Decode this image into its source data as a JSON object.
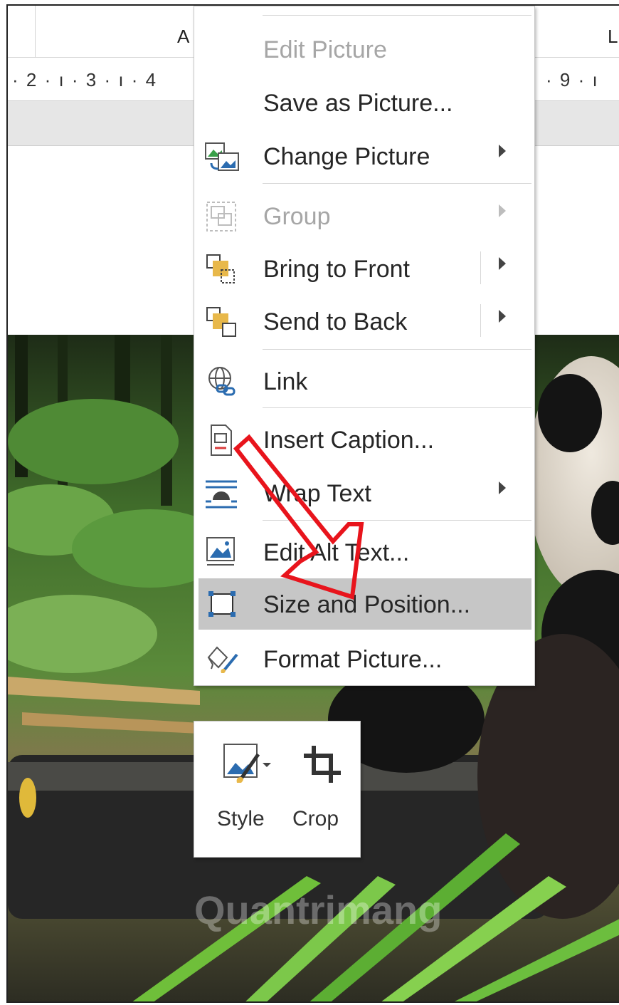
{
  "spreadsheet": {
    "column_headers": [
      "A",
      "L"
    ],
    "ruler_left": "· 2 · ı · 3 · ı · 4",
    "ruler_right": "· 9 · ı"
  },
  "context_menu": {
    "items": [
      {
        "label": "Edit Picture",
        "icon": "none",
        "enabled": false,
        "submenu": false
      },
      {
        "label": "Save as Picture...",
        "icon": "none",
        "enabled": true,
        "submenu": false
      },
      {
        "label": "Change Picture",
        "icon": "change-picture-icon",
        "enabled": true,
        "submenu": true
      },
      {
        "label": "Group",
        "icon": "group-icon",
        "enabled": false,
        "submenu": true
      },
      {
        "label": "Bring to Front",
        "icon": "bring-to-front-icon",
        "enabled": true,
        "submenu": true
      },
      {
        "label": "Send to Back",
        "icon": "send-to-back-icon",
        "enabled": true,
        "submenu": true
      },
      {
        "label": "Link",
        "icon": "link-icon",
        "enabled": true,
        "submenu": false
      },
      {
        "label": "Insert Caption...",
        "icon": "insert-caption-icon",
        "enabled": true,
        "submenu": false
      },
      {
        "label": "Wrap Text",
        "icon": "wrap-text-icon",
        "enabled": true,
        "submenu": true
      },
      {
        "label": "Edit Alt Text...",
        "icon": "alt-text-icon",
        "enabled": true,
        "submenu": false
      },
      {
        "label": "Size and Position...",
        "icon": "size-position-icon",
        "enabled": true,
        "submenu": false,
        "highlighted": true
      },
      {
        "label": "Format Picture...",
        "icon": "format-picture-icon",
        "enabled": true,
        "submenu": false
      }
    ]
  },
  "mini_toolbar": {
    "style_label": "Style",
    "crop_label": "Crop"
  },
  "watermark": "Quantrimang",
  "colors": {
    "highlight": "#c6c6c6",
    "annotation_arrow": "#e8141c",
    "icon_blue": "#2b6cb0",
    "icon_gold": "#e8b84a"
  }
}
